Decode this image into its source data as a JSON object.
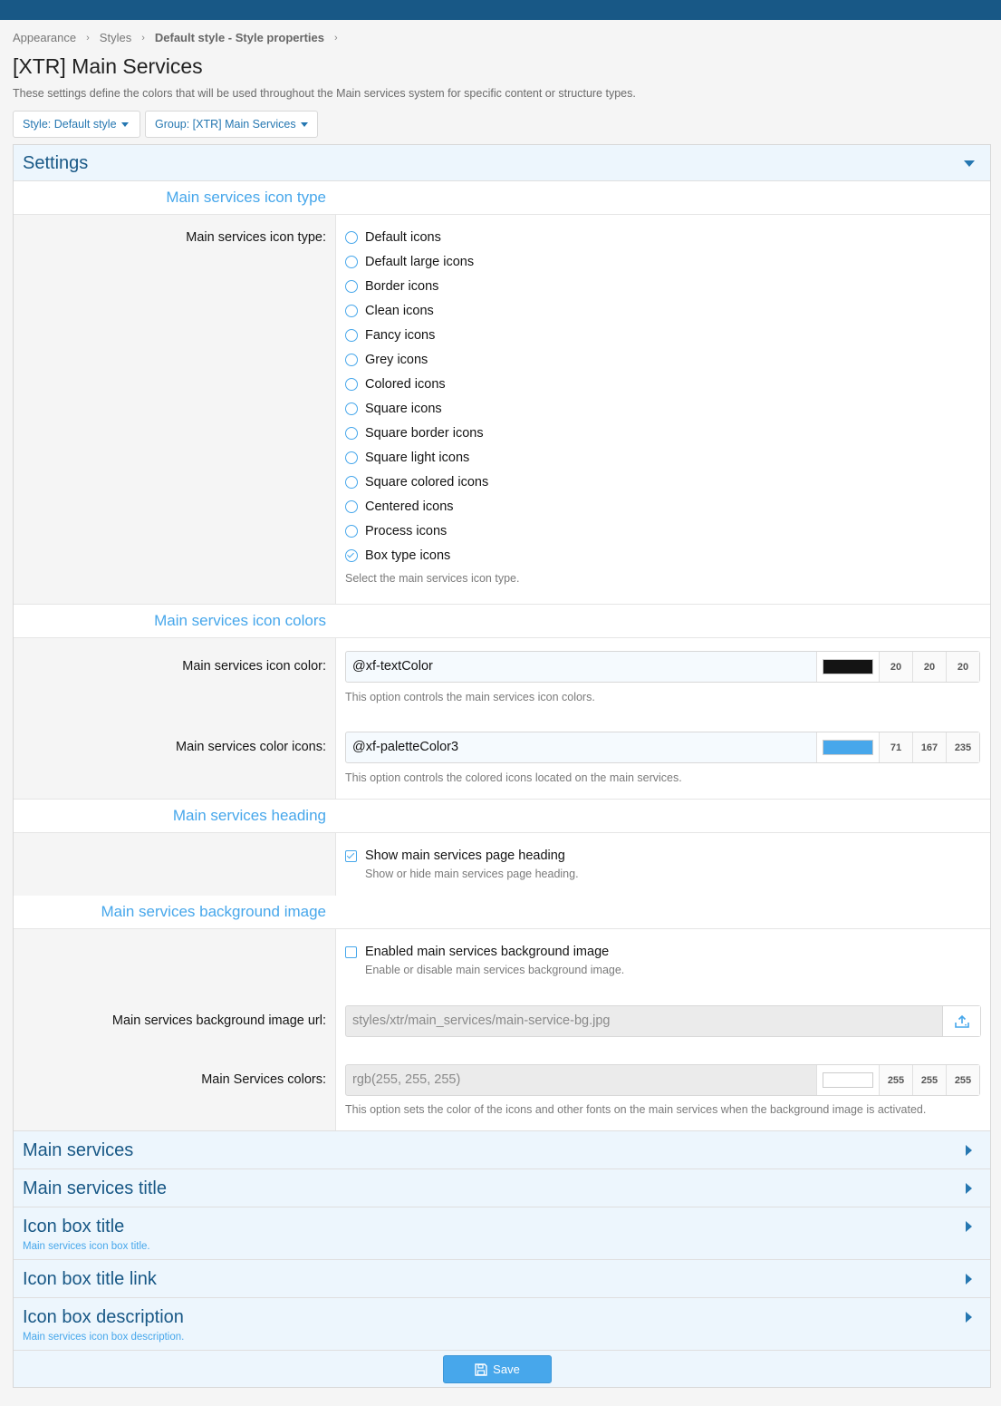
{
  "breadcrumb": {
    "item1": "Appearance",
    "item2": "Styles",
    "item3": "Default style - Style properties"
  },
  "page": {
    "title": "[XTR] Main Services",
    "description": "These settings define the colors that will be used throughout the Main services system for specific content or structure types."
  },
  "filters": {
    "style_label": "Style: Default style",
    "group_label": "Group: [XTR] Main Services"
  },
  "settings": {
    "header": "Settings",
    "icon_type": {
      "section": "Main services icon type",
      "label": "Main services icon type:",
      "options": [
        "Default icons",
        "Default large icons",
        "Border icons",
        "Clean icons",
        "Fancy icons",
        "Grey icons",
        "Colored icons",
        "Square icons",
        "Square border icons",
        "Square light icons",
        "Square colored icons",
        "Centered icons",
        "Process icons",
        "Box type icons"
      ],
      "selected": "Box type icons",
      "hint": "Select the main services icon type."
    },
    "icon_colors": {
      "section": "Main services icon colors",
      "icon_color": {
        "label": "Main services icon color:",
        "value": "@xf-textColor",
        "swatch": "#141414",
        "r": "20",
        "g": "20",
        "b": "20",
        "hint": "This option controls the main services icon colors."
      },
      "color_icons": {
        "label": "Main services color icons:",
        "value": "@xf-paletteColor3",
        "swatch": "#47a7eb",
        "r": "71",
        "g": "167",
        "b": "235",
        "hint": "This option controls the colored icons located on the main services."
      }
    },
    "heading": {
      "section": "Main services heading",
      "checkbox_label": "Show main services page heading",
      "checked": true,
      "hint": "Show or hide main services page heading."
    },
    "background": {
      "section": "Main services background image",
      "checkbox_label": "Enabled main services background image",
      "checked": false,
      "checkbox_hint": "Enable or disable main services background image.",
      "url_label": "Main services background image url:",
      "url_value": "styles/xtr/main_services/main-service-bg.jpg",
      "colors_label": "Main Services colors:",
      "colors_value": "rgb(255, 255, 255)",
      "colors_swatch": "#ffffff",
      "r": "255",
      "g": "255",
      "b": "255",
      "colors_hint": "This option sets the color of the icons and other fonts on the main services when the background image is activated."
    }
  },
  "collapsed": [
    {
      "title": "Main services",
      "desc": ""
    },
    {
      "title": "Main services title",
      "desc": ""
    },
    {
      "title": "Icon box title",
      "desc": "Main services icon box title."
    },
    {
      "title": "Icon box title link",
      "desc": ""
    },
    {
      "title": "Icon box description",
      "desc": "Main services icon box description."
    }
  ],
  "save_label": "Save",
  "colors": {
    "accent": "#47a7eb",
    "brand": "#185886",
    "header_bg": "#edf6fd"
  }
}
